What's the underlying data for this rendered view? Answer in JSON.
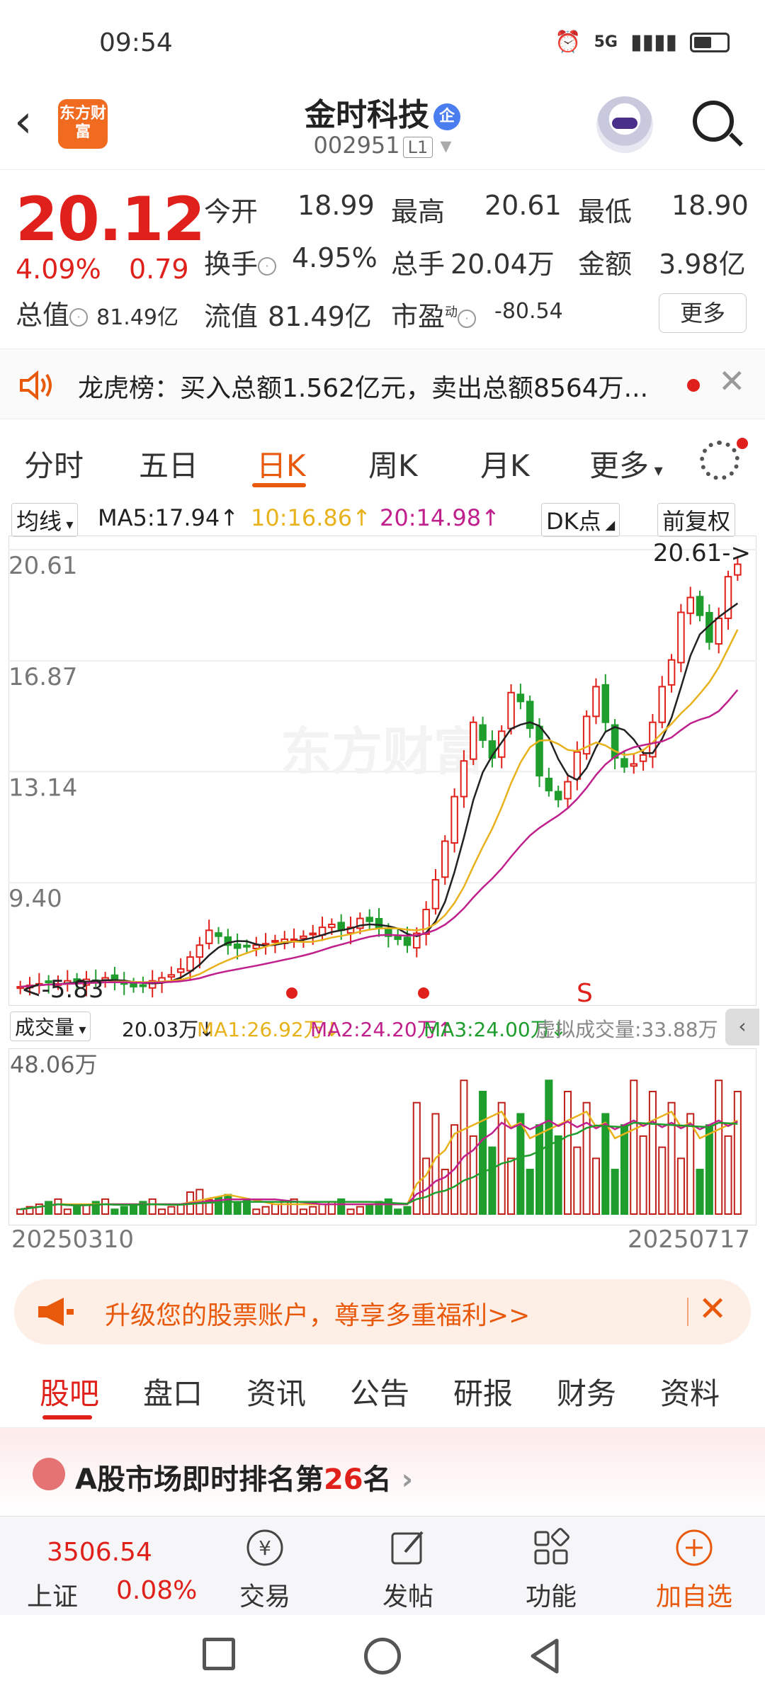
{
  "status": {
    "time": "09:54",
    "net": "5G"
  },
  "header": {
    "logo": "东方财富",
    "title": "金时科技",
    "tag": "企",
    "code": "002951",
    "level": "L1"
  },
  "quote": {
    "price": "20.12",
    "change_pct": "4.09%",
    "change": "0.79",
    "open_label": "今开",
    "open": "18.99",
    "high_label": "最高",
    "high": "20.61",
    "low_label": "最低",
    "low": "18.90",
    "turnover_label": "换手",
    "turnover": "4.95%",
    "volume_label": "总手",
    "volume": "20.04万",
    "amount_label": "金额",
    "amount": "3.98亿",
    "mktcap_label": "总值",
    "mktcap": "81.49亿",
    "float_label": "流值",
    "float": "81.49亿",
    "pe_label": "市盈",
    "pe_sup": "动",
    "pe": "-80.54",
    "more": "更多"
  },
  "announce": {
    "text": "龙虎榜：买入总额1.562亿元，卖出总额8564万..."
  },
  "tabs": [
    "分时",
    "五日",
    "日K",
    "周K",
    "月K",
    "更多"
  ],
  "ma": {
    "select": "均线",
    "ma5": "MA5:17.94↑",
    "ma10": "10:16.86↑",
    "ma20": "20:14.98↑",
    "dk": "DK点",
    "fq": "前复权",
    "colors": {
      "ma5": "#222222",
      "ma10": "#e8b21c",
      "ma20": "#c0208c"
    }
  },
  "chart_data": {
    "type": "candlestick",
    "y_ticks": [
      "20.61",
      "16.87",
      "13.14",
      "9.40"
    ],
    "high_marker": "20.61->",
    "low_marker": "5.83",
    "signal": "S",
    "start_date": "20250310",
    "end_date": "20250717",
    "watermark": "东方财富",
    "closes": [
      5.9,
      5.95,
      6.0,
      6.05,
      6.0,
      6.1,
      6.05,
      6.15,
      6.1,
      6.2,
      6.1,
      6.0,
      5.9,
      5.95,
      6.1,
      6.2,
      6.3,
      6.5,
      6.9,
      7.3,
      7.8,
      7.6,
      7.3,
      7.2,
      7.25,
      7.3,
      7.35,
      7.45,
      7.5,
      7.5,
      7.6,
      7.7,
      7.9,
      8.0,
      7.8,
      7.9,
      8.2,
      8.1,
      7.9,
      7.6,
      7.5,
      7.3,
      7.7,
      8.5,
      9.5,
      10.8,
      12.3,
      13.5,
      14.8,
      14.2,
      13.6,
      14.5,
      15.8,
      15.5,
      14.6,
      13.0,
      12.5,
      12.2,
      12.8,
      13.8,
      15.0,
      16.0,
      14.8,
      13.6,
      13.3,
      13.4,
      13.7,
      14.8,
      16.0,
      16.9,
      18.5,
      19.0,
      18.4,
      17.5,
      18.3,
      19.7,
      20.12
    ],
    "volume": {
      "label": "成交量",
      "value": "20.03万↓",
      "ma1": "MA1:26.92万↓",
      "ma2": "MA2:24.20万↑",
      "ma3": "MA3:24.00万↓",
      "virtual": "虚拟成交量:33.88万",
      "max_label": "48.06万"
    }
  },
  "promo": {
    "text": "升级您的股票账户，尊享多重福利>>"
  },
  "infotabs": [
    "股吧",
    "盘口",
    "资讯",
    "公告",
    "研报",
    "财务",
    "资料"
  ],
  "rank": {
    "prefix": "A股市场即时排名第",
    "num": "26",
    "suffix": "名"
  },
  "bottomnav": {
    "index_value": "3506.54",
    "index_name": "上证",
    "index_change": "0.08%",
    "items": [
      "交易",
      "发帖",
      "功能",
      "加自选"
    ]
  }
}
